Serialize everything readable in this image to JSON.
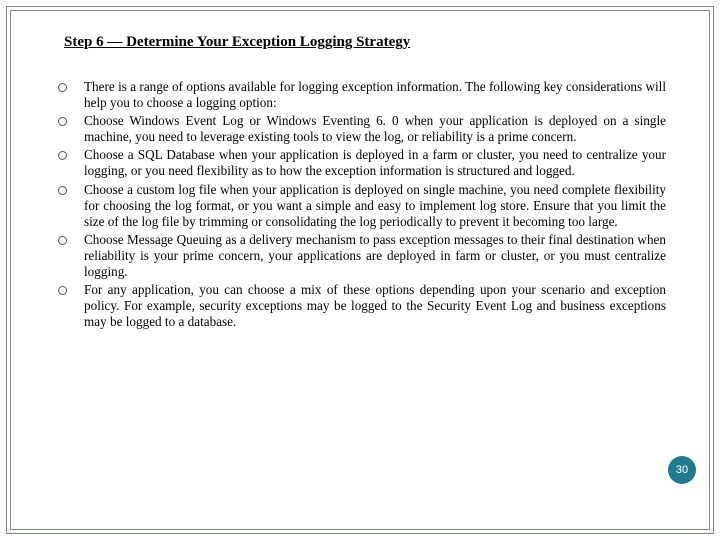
{
  "heading": "Step 6 — Determine Your Exception Logging Strategy",
  "bullets": [
    "There is a range of options available for logging exception information. The following key considerations will help you to choose a logging option:",
    "Choose Windows Event Log or Windows Eventing 6. 0 when your application is deployed on a single machine, you need to leverage existing tools to view the log, or reliability is a prime concern.",
    "Choose a SQL Database when your application is deployed in a farm or cluster, you need to centralize your logging, or you need flexibility as to how the exception information is structured and logged.",
    "Choose a custom log file when your application is deployed on single machine, you need complete flexibility for choosing the log format, or you want a simple and easy to implement log store. Ensure that you limit the size of the log file by trimming or consolidating the log periodically to prevent it becoming too large.",
    "Choose Message Queuing as a delivery mechanism to pass exception messages to their final destination when reliability is your prime concern, your applications are deployed in farm or cluster, or you must centralize logging.",
    "For any application, you can choose a mix of these options depending upon your scenario and exception policy. For example, security exceptions may be logged to the Security Event Log and business exceptions may be logged to a database."
  ],
  "page_number": "30"
}
